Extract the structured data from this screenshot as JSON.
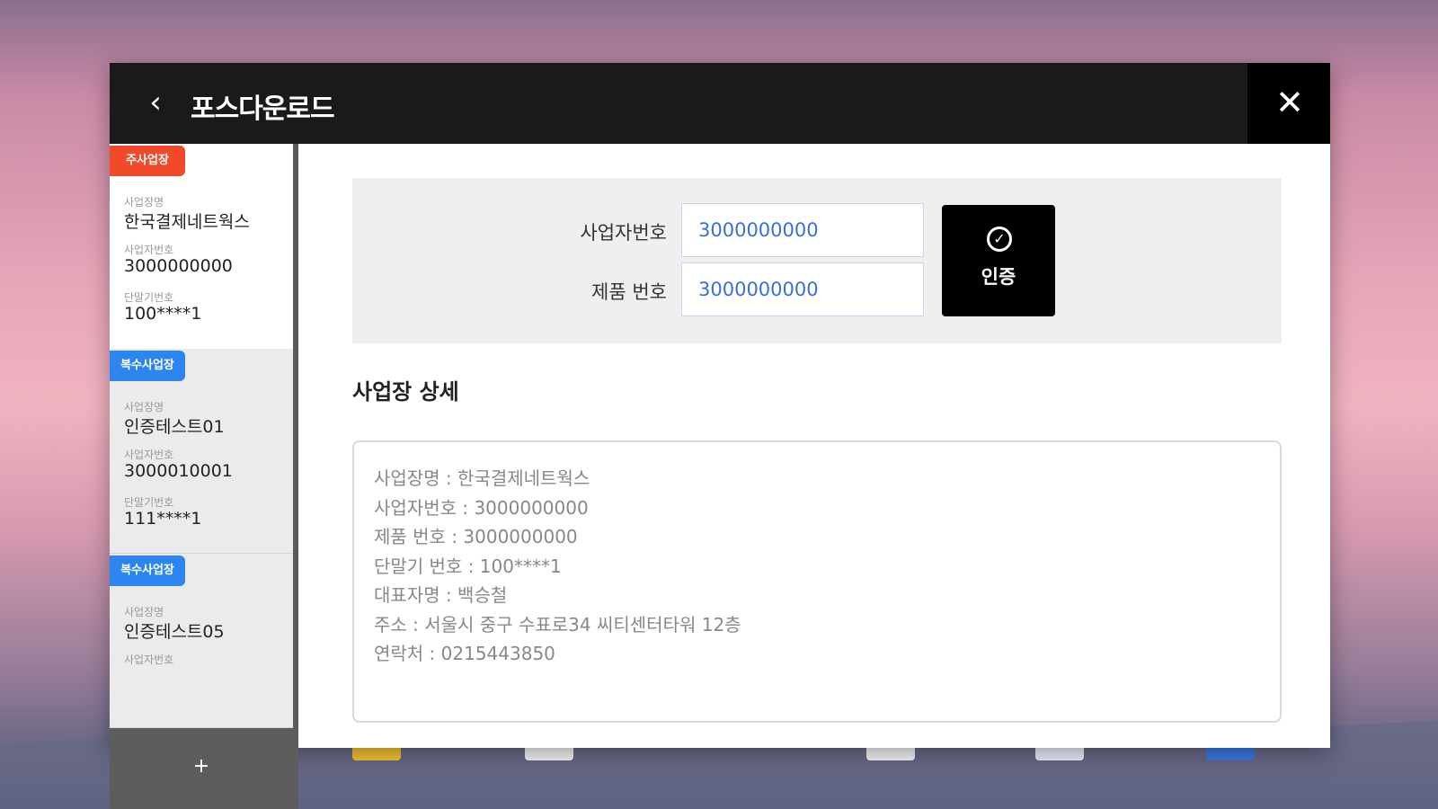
{
  "window": {
    "title": "포스다운로드",
    "back_icon": "chevron-left-icon",
    "close_icon": "close-icon"
  },
  "sidebar": {
    "cards": [
      {
        "badge": "주사업장",
        "badge_color": "#f04a2a",
        "name_label": "사업장명",
        "name": "한국결제네트웍스",
        "bizno_label": "사업자번호",
        "bizno": "3000000000",
        "term_label": "단말기번호",
        "term": "100****1"
      },
      {
        "badge": "복수사업장",
        "badge_color": "#2d86f0",
        "name_label": "사업장명",
        "name": "인증테스트01",
        "bizno_label": "사업자번호",
        "bizno": "3000010001",
        "term_label": "단말기번호",
        "term": "111****1"
      },
      {
        "badge": "복수사업장",
        "badge_color": "#2d86f0",
        "name_label": "사업장명",
        "name": "인증테스트05",
        "bizno_label": "사업자번호"
      }
    ],
    "add_label": "+"
  },
  "auth": {
    "bizno_label": "사업자번호",
    "bizno_value": "3000000000",
    "product_label": "제품 번호",
    "product_value": "3000000000",
    "button_label": "인증",
    "button_icon": "check-circle-icon"
  },
  "detail": {
    "title": "사업장 상세",
    "lines": [
      "사업장명 : 한국결제네트웍스",
      "사업자번호 : 3000000000",
      "제품 번호 : 3000000000",
      "단말기 번호 : 100****1",
      "대표자명 : 백승철",
      "주소 : 서울시 중구 수표로34 씨티센터타워 12층",
      "연락처 : 0215443850"
    ]
  }
}
